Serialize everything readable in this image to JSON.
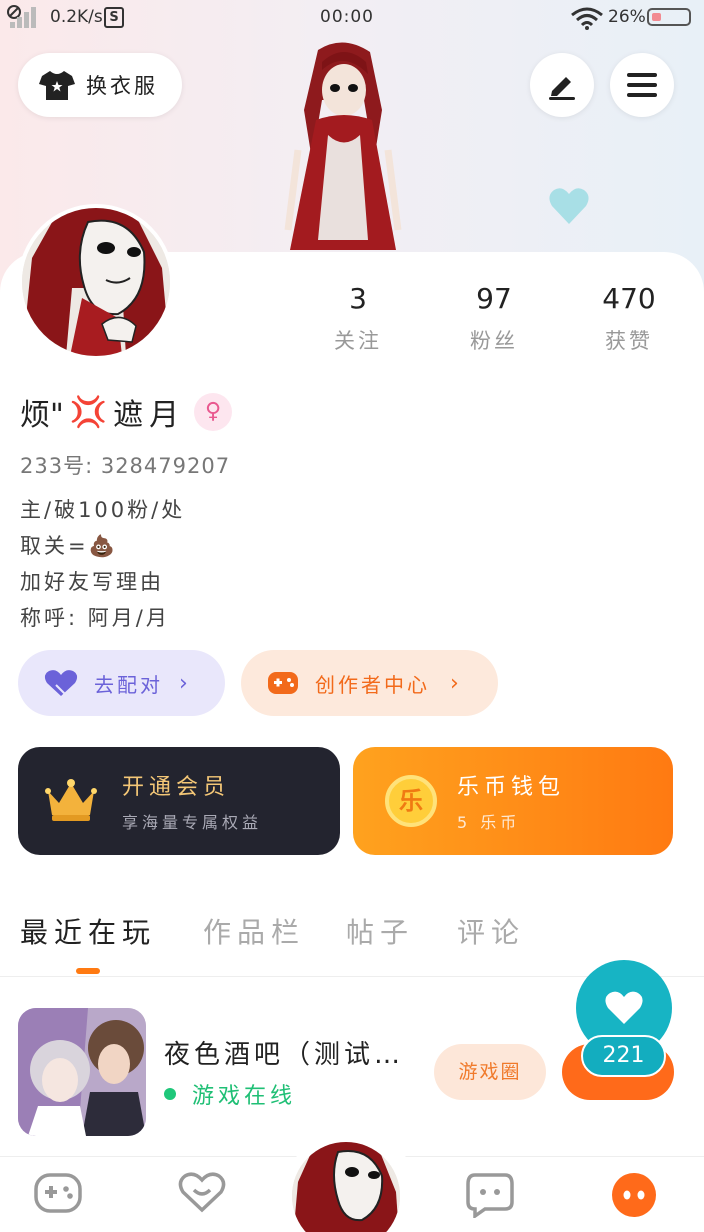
{
  "status_bar": {
    "speed": "0.2K/s",
    "s_badge": "S",
    "time": "00:00",
    "battery": "26%"
  },
  "header": {
    "outfit_label": "换衣服",
    "edit_icon": "pen-icon",
    "menu_icon": "hamburger-menu-icon"
  },
  "profile": {
    "stats": [
      {
        "value": "3",
        "label": "关注"
      },
      {
        "value": "97",
        "label": "粉丝"
      },
      {
        "value": "470",
        "label": "获赞"
      }
    ],
    "nickname_prefix": "烦\"",
    "nickname_emoji": "💢",
    "nickname_suffix": "遮月",
    "gender_symbol": "♀",
    "uid": "233号: 328479207",
    "bio": [
      "主/破100粉/处",
      "取关=",
      "加好友写理由",
      "称呼: 阿月/月"
    ],
    "bio_emoji": "💩"
  },
  "actions": {
    "pair_label": "去配对",
    "creator_label": "创作者中心"
  },
  "cards": {
    "vip": {
      "title": "开通会员",
      "subtitle": "享海量专属权益"
    },
    "wallet": {
      "title": "乐币钱包",
      "subtitle": "5 乐币",
      "coin_char": "乐"
    }
  },
  "tabs": [
    {
      "label": "最近在玩",
      "active": true
    },
    {
      "label": "作品栏",
      "active": false
    },
    {
      "label": "帖子",
      "active": false
    },
    {
      "label": "评论",
      "active": false
    }
  ],
  "recent_game": {
    "name": "夜色酒吧（测试…",
    "status": "游戏在线",
    "circle_label": "游戏圈"
  },
  "float_like": {
    "count": "221"
  },
  "colors": {
    "accent_orange": "#ff6a1a",
    "teal": "#17b4c4",
    "online_green": "#1fbf75",
    "pair_purple": "#6b62d9"
  }
}
